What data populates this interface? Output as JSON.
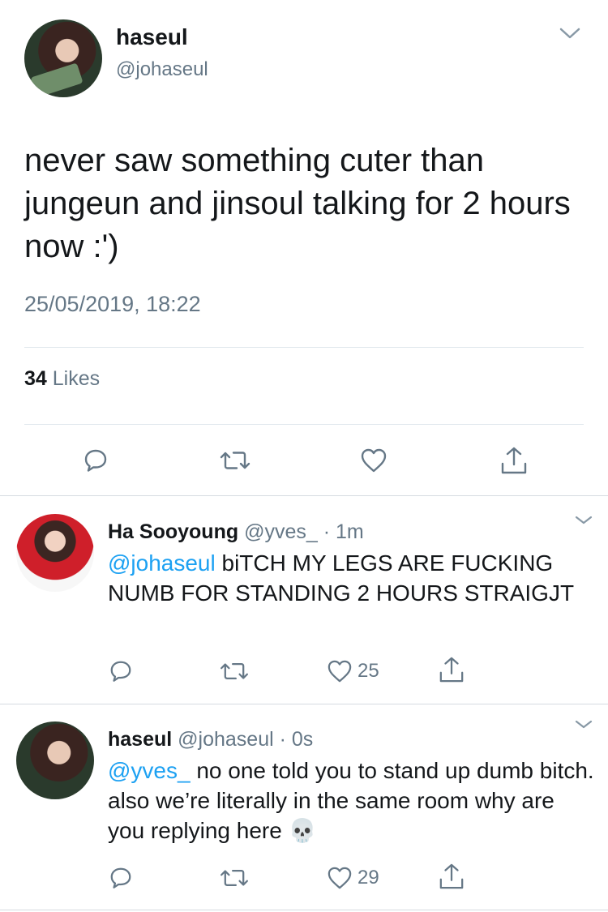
{
  "tweet": {
    "author_name": "haseul",
    "author_handle": "@johaseul",
    "text": "never saw something cuter than jungeun and jinsoul talking for 2 hours now :')",
    "timestamp": "25/05/2019, 18:22",
    "likes_count": "34",
    "likes_label": " Likes"
  },
  "replies": [
    {
      "author_name": "Ha Sooyoung",
      "meta": "@yves_ · 1m",
      "mention": "@johaseul",
      "text": " biTCH MY LEGS ARE FUCKING NUMB FOR STANDING 2 HOURS STRAIGJT",
      "like_count": "25"
    },
    {
      "author_name": "haseul",
      "meta": "@johaseul · 0s",
      "mention": "@yves_",
      "text": " no one told you to stand up dumb bitch. also we’re literally in the same room why are you replying here",
      "emoji": "💀",
      "like_count": "29"
    }
  ],
  "icons": {
    "reply": "speech-bubble-icon",
    "retweet": "retweet-icon",
    "like": "heart-icon",
    "share": "share-icon",
    "more": "chevron-down-icon"
  },
  "colors": {
    "text": "#14171a",
    "secondary": "#657786",
    "link": "#1da1f2",
    "divider": "#e1e8ed"
  }
}
